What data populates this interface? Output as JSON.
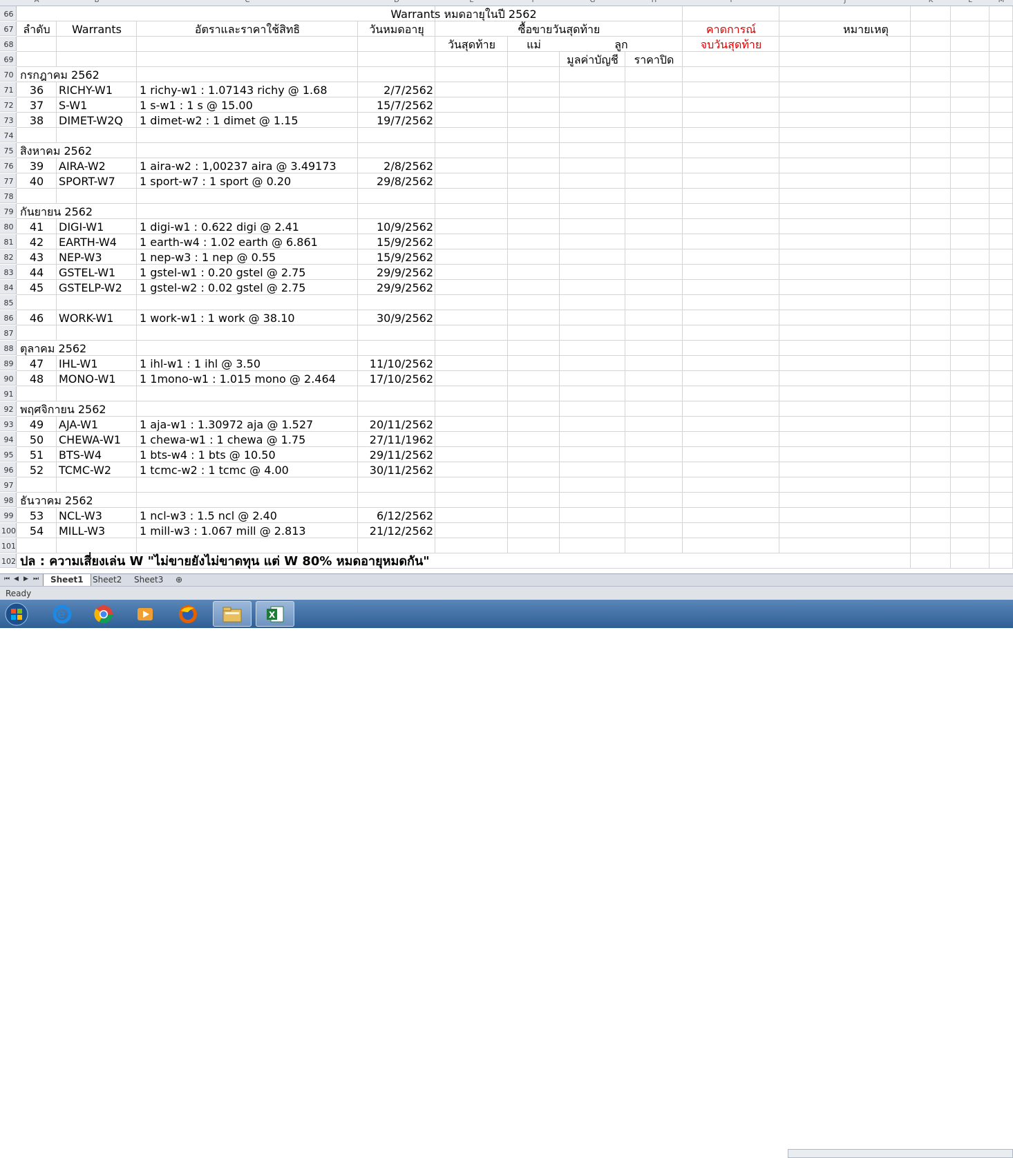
{
  "columns": [
    "A",
    "B",
    "C",
    "D",
    "E",
    "F",
    "G",
    "H",
    "I",
    "J",
    "K",
    "L",
    "M"
  ],
  "title": "Warrants หมดอายุในปี 2562",
  "header": {
    "no": "ลำดับ",
    "warrants": "Warrants",
    "ratio": "อัตราและราคาใช้สิทธิ",
    "expiry": "วันหมดอายุ",
    "last_trade": "ซื้อขายวันสุดท้าย",
    "forecast": "คาดการณ์",
    "forecast2": "จบวันสุดท้าย",
    "note": "หมายเหตุ",
    "last_day": "วันสุดท้าย",
    "mother": "แม่",
    "child": "ลูก",
    "book_value": "มูลค่าบัญชี",
    "close_price": "ราคาปิด"
  },
  "rows": [
    {
      "r": "66",
      "type": "title"
    },
    {
      "r": "67",
      "type": "h1"
    },
    {
      "r": "68",
      "type": "h2"
    },
    {
      "r": "69",
      "type": "h3"
    },
    {
      "r": "70",
      "type": "month",
      "label": "กรกฎาคม 2562"
    },
    {
      "r": "71",
      "type": "data",
      "no": "36",
      "w": "RICHY-W1",
      "ratio": "1 richy-w1 : 1.07143 richy @ 1.68",
      "date": "2/7/2562"
    },
    {
      "r": "72",
      "type": "data",
      "no": "37",
      "w": "S-W1",
      "ratio": "1 s-w1 : 1 s @ 15.00",
      "date": "15/7/2562"
    },
    {
      "r": "73",
      "type": "data",
      "no": "38",
      "w": "DIMET-W2Q",
      "ratio": "1 dimet-w2 : 1 dimet @ 1.15",
      "date": "19/7/2562"
    },
    {
      "r": "74",
      "type": "blank"
    },
    {
      "r": "75",
      "type": "month",
      "label": "สิงหาคม 2562"
    },
    {
      "r": "76",
      "type": "data",
      "no": "39",
      "w": "AIRA-W2",
      "ratio": "1 aira-w2 : 1,00237 aira @ 3.49173",
      "date": "2/8/2562"
    },
    {
      "r": "77",
      "type": "data",
      "no": "40",
      "w": "SPORT-W7",
      "ratio": "1 sport-w7 : 1 sport @ 0.20",
      "date": "29/8/2562"
    },
    {
      "r": "78",
      "type": "blank"
    },
    {
      "r": "79",
      "type": "month",
      "label": "กันยายน 2562"
    },
    {
      "r": "80",
      "type": "data",
      "no": "41",
      "w": "DIGI-W1",
      "ratio": "1 digi-w1 : 0.622 digi @ 2.41",
      "date": "10/9/2562"
    },
    {
      "r": "81",
      "type": "data",
      "no": "42",
      "w": "EARTH-W4",
      "ratio": "1 earth-w4 : 1.02 earth @ 6.861",
      "date": "15/9/2562"
    },
    {
      "r": "82",
      "type": "data",
      "no": "43",
      "w": "NEP-W3",
      "ratio": "1 nep-w3 : 1 nep @ 0.55",
      "date": "15/9/2562"
    },
    {
      "r": "83",
      "type": "data",
      "no": "44",
      "w": "GSTEL-W1",
      "ratio": "1 gstel-w1 : 0.20 gstel @ 2.75",
      "date": "29/9/2562"
    },
    {
      "r": "84",
      "type": "data",
      "no": "45",
      "w": "GSTELP-W2",
      "ratio": "1 gstel-w2 : 0.02 gstel @ 2.75",
      "date": "29/9/2562"
    },
    {
      "r": "85",
      "type": "blank"
    },
    {
      "r": "86",
      "type": "data",
      "no": "46",
      "w": "WORK-W1",
      "ratio": "1 work-w1 : 1 work @ 38.10",
      "date": "30/9/2562"
    },
    {
      "r": "87",
      "type": "blank"
    },
    {
      "r": "88",
      "type": "month",
      "label": "ตุลาคม 2562"
    },
    {
      "r": "89",
      "type": "data",
      "no": "47",
      "w": "IHL-W1",
      "ratio": "1 ihl-w1 : 1 ihl @ 3.50",
      "date": "11/10/2562"
    },
    {
      "r": "90",
      "type": "data",
      "no": "48",
      "w": "MONO-W1",
      "ratio": "1 1mono-w1 : 1.015 mono @ 2.464",
      "date": "17/10/2562"
    },
    {
      "r": "91",
      "type": "blank"
    },
    {
      "r": "92",
      "type": "month",
      "label": "พฤศจิกายน 2562"
    },
    {
      "r": "93",
      "type": "data",
      "no": "49",
      "w": "AJA-W1",
      "ratio": "1 aja-w1 : 1.30972 aja @ 1.527",
      "date": "20/11/2562"
    },
    {
      "r": "94",
      "type": "data",
      "no": "50",
      "w": "CHEWA-W1",
      "ratio": "1 chewa-w1 : 1 chewa @ 1.75",
      "date": "27/11/1962"
    },
    {
      "r": "95",
      "type": "data",
      "no": "51",
      "w": "BTS-W4",
      "ratio": "1 bts-w4 : 1 bts @ 10.50",
      "date": "29/11/2562"
    },
    {
      "r": "96",
      "type": "data",
      "no": "52",
      "w": "TCMC-W2",
      "ratio": "1 tcmc-w2 : 1 tcmc @ 4.00",
      "date": "30/11/2562"
    },
    {
      "r": "97",
      "type": "blank"
    },
    {
      "r": "98",
      "type": "month",
      "label": "ธันวาคม 2562"
    },
    {
      "r": "99",
      "type": "data",
      "no": "53",
      "w": "NCL-W3",
      "ratio": "1 ncl-w3 : 1.5 ncl @ 2.40",
      "date": "6/12/2562"
    },
    {
      "r": "100",
      "type": "data",
      "no": "54",
      "w": "MILL-W3",
      "ratio": "1 mill-w3 : 1.067 mill @ 2.813",
      "date": "21/12/2562"
    },
    {
      "r": "101",
      "type": "blank"
    },
    {
      "r": "102",
      "type": "footer",
      "label": "ปล : ความเสี่ยงเล่น W  \"ไม่ขายยังไม่ขาดทุน  แต่ W 80% หมดอายุหมดกัน\""
    }
  ],
  "tabs": [
    "Sheet1",
    "Sheet2",
    "Sheet3"
  ],
  "status": "Ready",
  "taskbar": [
    "start-orb",
    "internet-explorer-icon",
    "chrome-icon",
    "media-player-icon",
    "firefox-icon",
    "file-explorer-icon",
    "excel-icon"
  ],
  "colors": {
    "red": "#e00000",
    "grid": "#d4d4d4",
    "header_bg": "#e6e9ee"
  }
}
